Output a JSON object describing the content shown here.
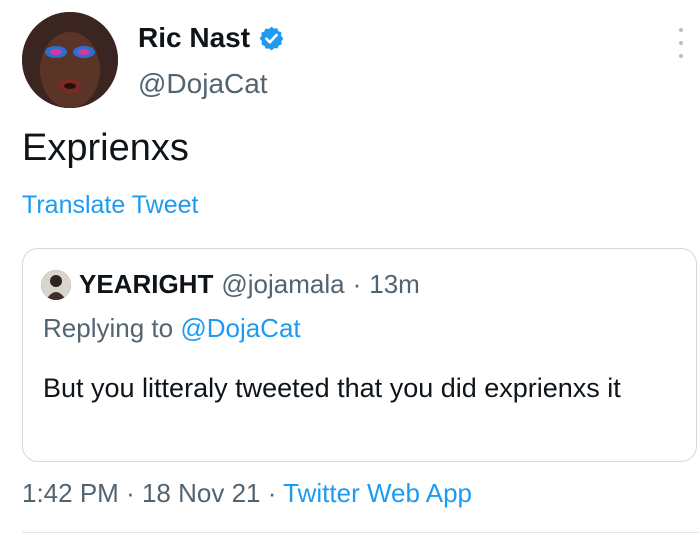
{
  "author": {
    "name": "Ric Nast",
    "handle": "@DojaCat",
    "verified_color": "#1d9bf0"
  },
  "tweet": {
    "text": "Exprienxs",
    "translate_label": "Translate Tweet"
  },
  "quoted": {
    "name": "YEARIGHT",
    "handle": "@jojamala",
    "separator": "·",
    "time": "13m",
    "replying_prefix": "Replying to ",
    "replying_handle": "@DojaCat",
    "text": "But you litteraly tweeted that you did exprienxs it"
  },
  "meta": {
    "time": "1:42 PM",
    "sep1": "·",
    "date": "18 Nov 21",
    "sep2": "·",
    "app": "Twitter Web App"
  },
  "colors": {
    "link": "#1d9bf0",
    "secondary": "#536471",
    "border": "#cfd9de"
  },
  "icons": {
    "verified": "verified-badge-icon",
    "more": "more-options-icon"
  }
}
